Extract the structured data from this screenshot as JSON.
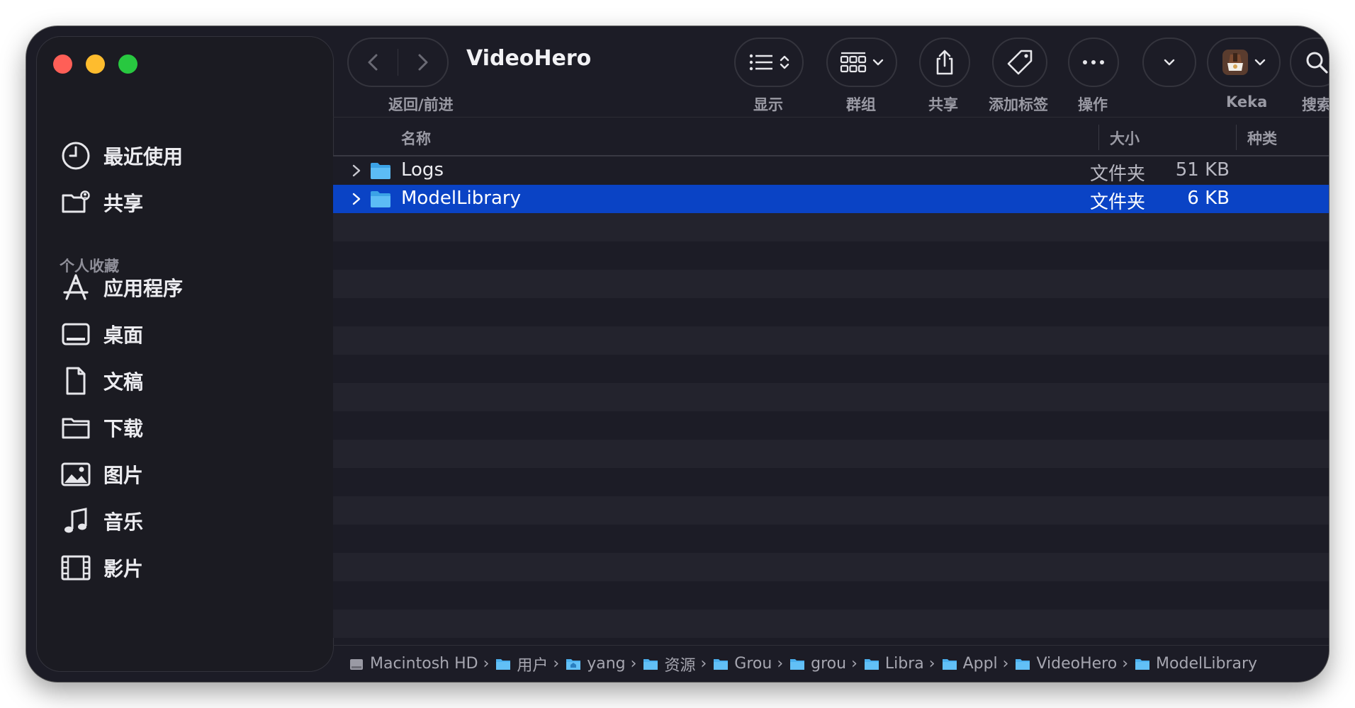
{
  "window": {
    "title": "VideoHero"
  },
  "sidebar": {
    "items": [
      {
        "label": "最近使用",
        "icon": "clock-icon"
      },
      {
        "label": "共享",
        "icon": "shared-folder-icon"
      }
    ],
    "section_title": "个人收藏",
    "favorites": [
      {
        "label": "应用程序",
        "icon": "applications-icon"
      },
      {
        "label": "桌面",
        "icon": "desktop-icon"
      },
      {
        "label": "文稿",
        "icon": "document-icon"
      },
      {
        "label": "下载",
        "icon": "downloads-folder-icon"
      },
      {
        "label": "图片",
        "icon": "photo-icon"
      },
      {
        "label": "音乐",
        "icon": "music-note-icon"
      },
      {
        "label": "影片",
        "icon": "film-icon"
      }
    ]
  },
  "toolbar": {
    "nav_label": "返回/前进",
    "view_label": "显示",
    "group_label": "群组",
    "share_label": "共享",
    "tag_label": "添加标签",
    "action_label": "操作",
    "keka_label": "Keka",
    "search_label": "搜索"
  },
  "columns": {
    "name": "名称",
    "size": "大小",
    "kind": "种类"
  },
  "files": [
    {
      "name": "Logs",
      "size": "51 KB",
      "kind": "文件夹",
      "selected": false
    },
    {
      "name": "ModelLibrary",
      "size": "6 KB",
      "kind": "文件夹",
      "selected": true
    }
  ],
  "pathbar": [
    {
      "label": "Macintosh HD",
      "icon": "disk-icon"
    },
    {
      "label": "用户",
      "icon": "folder-icon"
    },
    {
      "label": "yang",
      "icon": "home-folder-icon"
    },
    {
      "label": "资源",
      "icon": "folder-icon"
    },
    {
      "label": "Grou",
      "icon": "folder-icon"
    },
    {
      "label": "grou",
      "icon": "folder-icon"
    },
    {
      "label": "Libra",
      "icon": "folder-icon"
    },
    {
      "label": "Appl",
      "icon": "folder-icon"
    },
    {
      "label": "VideoHero",
      "icon": "folder-icon"
    },
    {
      "label": "ModelLibrary",
      "icon": "folder-icon"
    }
  ],
  "colors": {
    "window_bg": "#1c1c26",
    "sidebar_bg": "#1b1b22",
    "selection": "#0a43c5",
    "folder_blue": "#4bb0ef",
    "close": "#ff5f57",
    "minimize": "#febc2e",
    "zoom": "#28c840"
  }
}
